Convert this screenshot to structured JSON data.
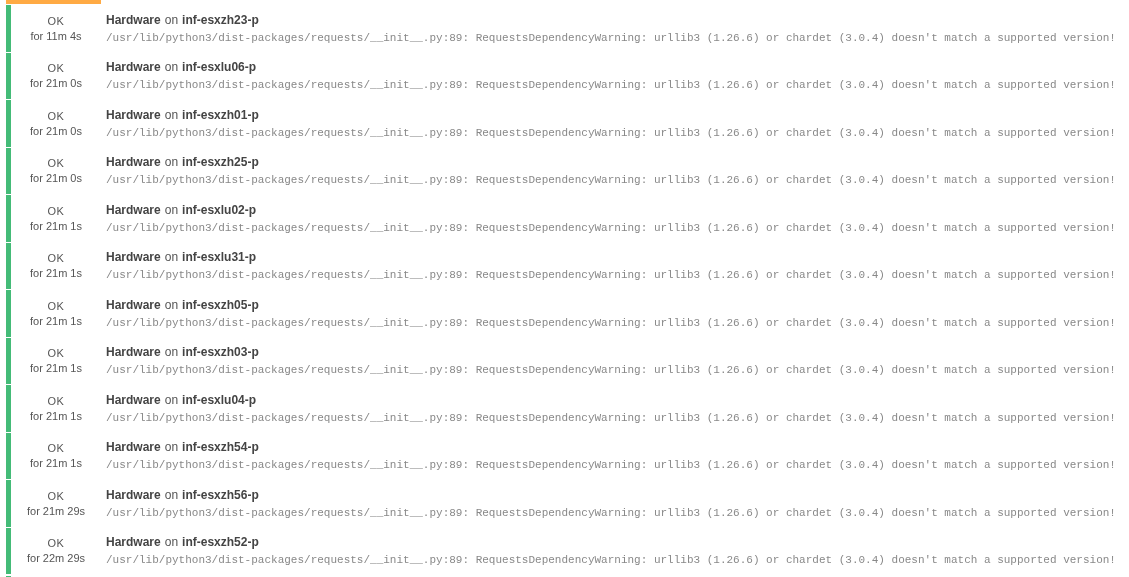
{
  "previous_row": {
    "kind": "warning"
  },
  "rows": [
    {
      "kind": "ok",
      "status": "OK",
      "duration": "for 11m 4s",
      "service": "Hardware",
      "on": "on",
      "host": "inf-esxzh23-p",
      "output": "/usr/lib/python3/dist-packages/requests/__init__.py:89: RequestsDependencyWarning: urllib3 (1.26.6) or chardet (3.0.4) doesn't match a supported version!"
    },
    {
      "kind": "ok",
      "status": "OK",
      "duration": "for 21m 0s",
      "service": "Hardware",
      "on": "on",
      "host": "inf-esxlu06-p",
      "output": "/usr/lib/python3/dist-packages/requests/__init__.py:89: RequestsDependencyWarning: urllib3 (1.26.6) or chardet (3.0.4) doesn't match a supported version!"
    },
    {
      "kind": "ok",
      "status": "OK",
      "duration": "for 21m 0s",
      "service": "Hardware",
      "on": "on",
      "host": "inf-esxzh01-p",
      "output": "/usr/lib/python3/dist-packages/requests/__init__.py:89: RequestsDependencyWarning: urllib3 (1.26.6) or chardet (3.0.4) doesn't match a supported version!"
    },
    {
      "kind": "ok",
      "status": "OK",
      "duration": "for 21m 0s",
      "service": "Hardware",
      "on": "on",
      "host": "inf-esxzh25-p",
      "output": "/usr/lib/python3/dist-packages/requests/__init__.py:89: RequestsDependencyWarning: urllib3 (1.26.6) or chardet (3.0.4) doesn't match a supported version!"
    },
    {
      "kind": "ok",
      "status": "OK",
      "duration": "for 21m 1s",
      "service": "Hardware",
      "on": "on",
      "host": "inf-esxlu02-p",
      "output": "/usr/lib/python3/dist-packages/requests/__init__.py:89: RequestsDependencyWarning: urllib3 (1.26.6) or chardet (3.0.4) doesn't match a supported version!"
    },
    {
      "kind": "ok",
      "status": "OK",
      "duration": "for 21m 1s",
      "service": "Hardware",
      "on": "on",
      "host": "inf-esxlu31-p",
      "output": "/usr/lib/python3/dist-packages/requests/__init__.py:89: RequestsDependencyWarning: urllib3 (1.26.6) or chardet (3.0.4) doesn't match a supported version!"
    },
    {
      "kind": "ok",
      "status": "OK",
      "duration": "for 21m 1s",
      "service": "Hardware",
      "on": "on",
      "host": "inf-esxzh05-p",
      "output": "/usr/lib/python3/dist-packages/requests/__init__.py:89: RequestsDependencyWarning: urllib3 (1.26.6) or chardet (3.0.4) doesn't match a supported version!"
    },
    {
      "kind": "ok",
      "status": "OK",
      "duration": "for 21m 1s",
      "service": "Hardware",
      "on": "on",
      "host": "inf-esxzh03-p",
      "output": "/usr/lib/python3/dist-packages/requests/__init__.py:89: RequestsDependencyWarning: urllib3 (1.26.6) or chardet (3.0.4) doesn't match a supported version!"
    },
    {
      "kind": "ok",
      "status": "OK",
      "duration": "for 21m 1s",
      "service": "Hardware",
      "on": "on",
      "host": "inf-esxlu04-p",
      "output": "/usr/lib/python3/dist-packages/requests/__init__.py:89: RequestsDependencyWarning: urllib3 (1.26.6) or chardet (3.0.4) doesn't match a supported version!"
    },
    {
      "kind": "ok",
      "status": "OK",
      "duration": "for 21m 1s",
      "service": "Hardware",
      "on": "on",
      "host": "inf-esxzh54-p",
      "output": "/usr/lib/python3/dist-packages/requests/__init__.py:89: RequestsDependencyWarning: urllib3 (1.26.6) or chardet (3.0.4) doesn't match a supported version!"
    },
    {
      "kind": "ok",
      "status": "OK",
      "duration": "for 21m 29s",
      "service": "Hardware",
      "on": "on",
      "host": "inf-esxzh56-p",
      "output": "/usr/lib/python3/dist-packages/requests/__init__.py:89: RequestsDependencyWarning: urllib3 (1.26.6) or chardet (3.0.4) doesn't match a supported version!"
    },
    {
      "kind": "ok",
      "status": "OK",
      "duration": "for 22m 29s",
      "service": "Hardware",
      "on": "on",
      "host": "inf-esxzh52-p",
      "output": "/usr/lib/python3/dist-packages/requests/__init__.py:89: RequestsDependencyWarning: urllib3 (1.26.6) or chardet (3.0.4) doesn't match a supported version!"
    }
  ],
  "next_row": {
    "kind": "ok"
  }
}
